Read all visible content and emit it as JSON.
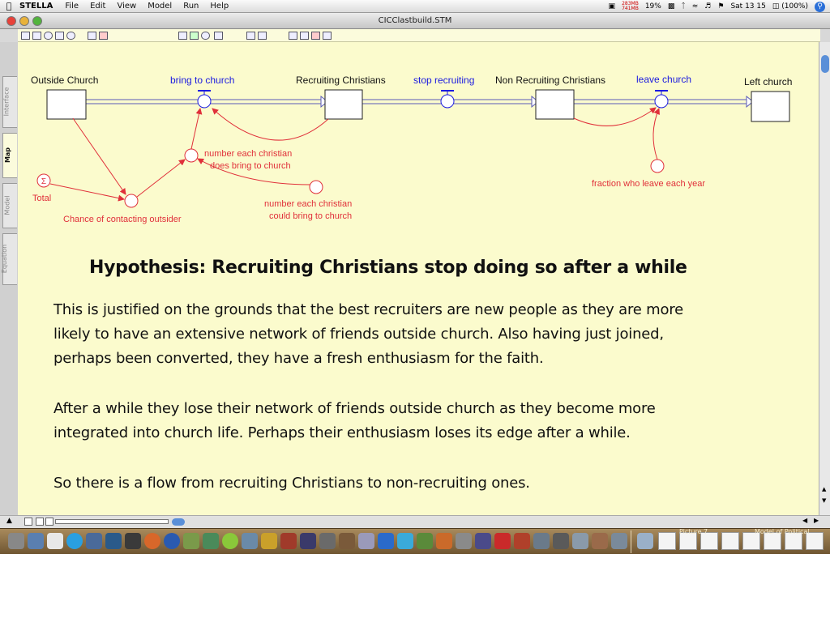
{
  "menubar": {
    "app_name": "STELLA",
    "menus": [
      "File",
      "Edit",
      "View",
      "Model",
      "Run",
      "Help"
    ],
    "memory_top": "283MB",
    "memory_bottom": "741MB",
    "cpu": "19%",
    "clock": "Sat 13 15",
    "battery": "(100%)"
  },
  "window": {
    "title": "CICClastbuild.STM"
  },
  "side_tabs": [
    "Interface",
    "Map",
    "Model",
    "Equation"
  ],
  "diagram": {
    "stocks": {
      "outside_church": "Outside Church",
      "recruiting_christians": "Recruiting Christians",
      "non_recruiting_christians": "Non Recruiting Christians",
      "left_church": "Left church"
    },
    "flows": {
      "bring_to_church": "bring to church",
      "stop_recruiting": "stop recruiting",
      "leave_church": "leave church"
    },
    "converters": {
      "number_each_christian_does_line1": "number each christian",
      "number_each_christian_does_line2": "does bring to church",
      "number_each_christian_could_line1": "number each christian",
      "number_each_christian_could_line2": "could bring to church",
      "total": "Total",
      "chance_of_contacting_outsider": "Chance of contacting outsider",
      "fraction_who_leave_each_year": "fraction who leave each year"
    },
    "colors": {
      "flow_label": "#1a1ae0",
      "connector": "#e0303a",
      "stock_border": "#222222"
    }
  },
  "slide": {
    "hypothesis": "Hypothesis: Recruiting Christians stop doing so after a while",
    "paragraph1_line1": "This is justified on the grounds that the best recruiters are new people as they are more",
    "paragraph1_line2": "likely to have an extensive network of friends outside church. Also having just joined,",
    "paragraph1_line3": "perhaps been converted, they have a fresh enthusiasm for the faith.",
    "paragraph2_line1": "After a while they lose their network of friends outside church as they become more",
    "paragraph2_line2": "integrated into church life. Perhaps their enthusiasm loses its edge after a while.",
    "paragraph3_line1": "So there is a flow from recruiting Christians to non-recruiting ones."
  },
  "dock": {
    "label_left": "Picture 7",
    "label_right": "Model of Political"
  }
}
